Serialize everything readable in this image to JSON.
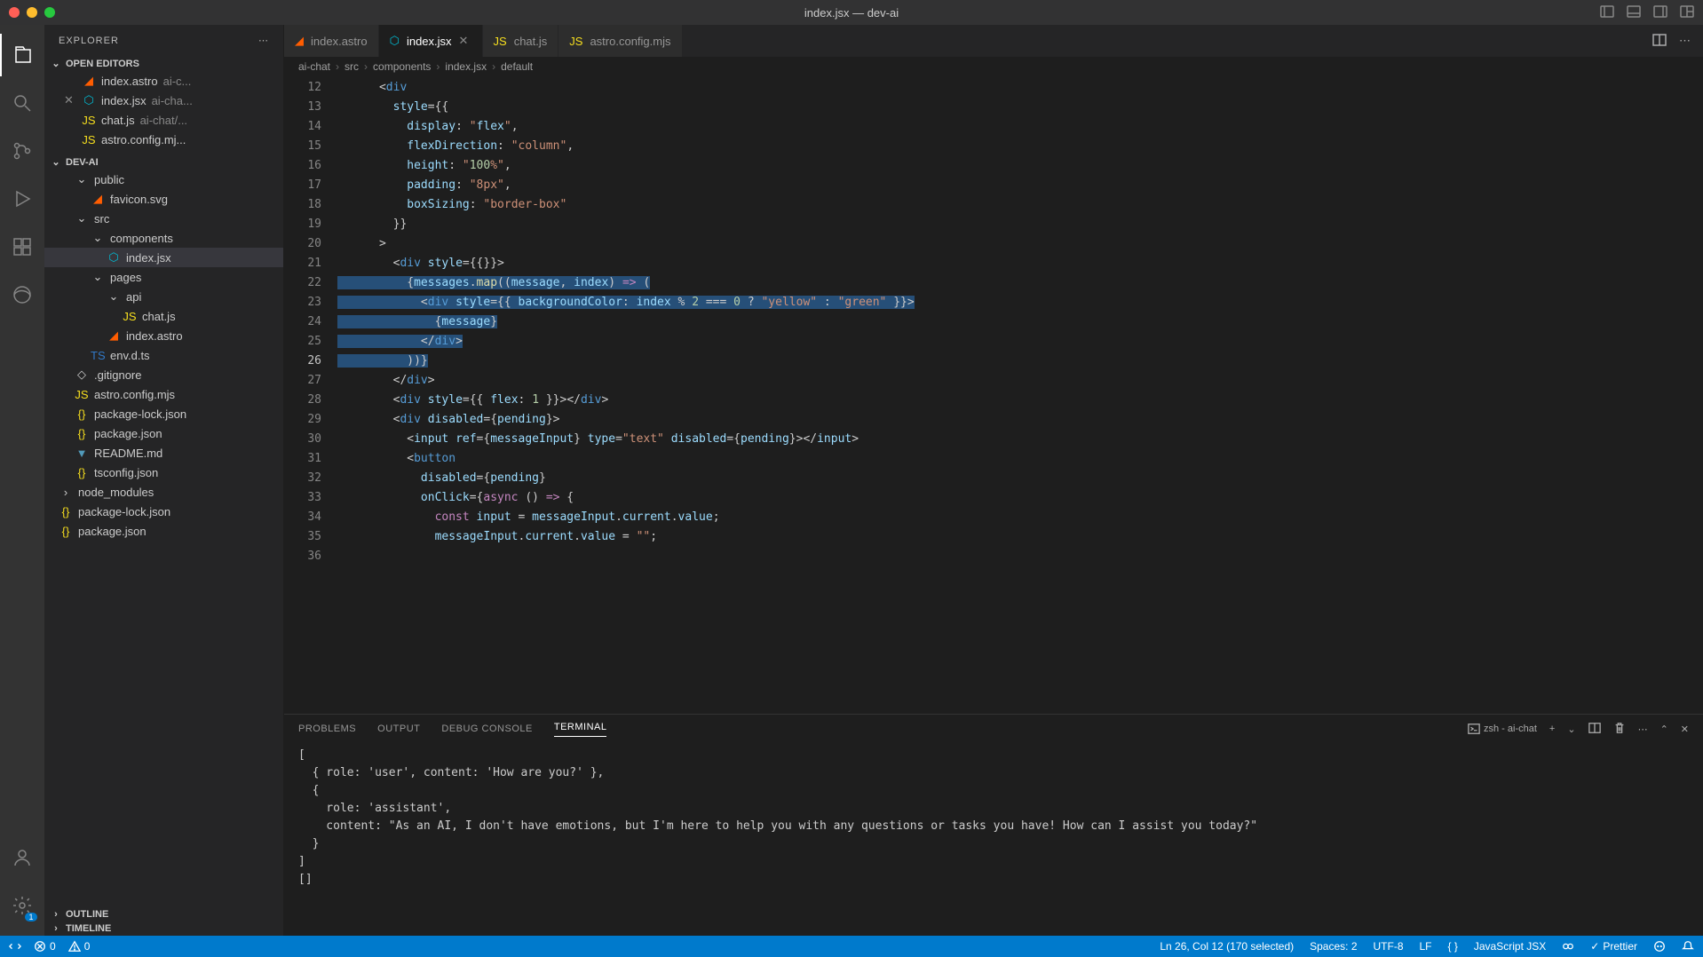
{
  "window": {
    "title": "index.jsx — dev-ai"
  },
  "explorer": {
    "title": "EXPLORER",
    "openEditorsLabel": "OPEN EDITORS",
    "projectLabel": "DEV-AI",
    "outlineLabel": "OUTLINE",
    "timelineLabel": "TIMELINE",
    "openEditors": [
      {
        "name": "index.astro",
        "path": "ai-c..."
      },
      {
        "name": "index.jsx",
        "path": "ai-cha..."
      },
      {
        "name": "chat.js",
        "path": "ai-chat/..."
      },
      {
        "name": "astro.config.mj...",
        "path": ""
      }
    ],
    "tree": [
      {
        "type": "folder",
        "depth": 1,
        "name": "public",
        "open": true
      },
      {
        "type": "file",
        "depth": 2,
        "name": "favicon.svg",
        "icon": "astro"
      },
      {
        "type": "folder",
        "depth": 1,
        "name": "src",
        "open": true
      },
      {
        "type": "folder",
        "depth": 2,
        "name": "components",
        "open": true
      },
      {
        "type": "file",
        "depth": 3,
        "name": "index.jsx",
        "icon": "jsx",
        "selected": true
      },
      {
        "type": "folder",
        "depth": 2,
        "name": "pages",
        "open": true
      },
      {
        "type": "folder",
        "depth": 3,
        "name": "api",
        "open": true
      },
      {
        "type": "file",
        "depth": 4,
        "name": "chat.js",
        "icon": "js"
      },
      {
        "type": "file",
        "depth": 3,
        "name": "index.astro",
        "icon": "astro"
      },
      {
        "type": "file",
        "depth": 2,
        "name": "env.d.ts",
        "icon": "ts"
      },
      {
        "type": "file",
        "depth": 1,
        "name": ".gitignore",
        "icon": ""
      },
      {
        "type": "file",
        "depth": 1,
        "name": "astro.config.mjs",
        "icon": "js"
      },
      {
        "type": "file",
        "depth": 1,
        "name": "package-lock.json",
        "icon": "json"
      },
      {
        "type": "file",
        "depth": 1,
        "name": "package.json",
        "icon": "json"
      },
      {
        "type": "file",
        "depth": 1,
        "name": "README.md",
        "icon": "md"
      },
      {
        "type": "file",
        "depth": 1,
        "name": "tsconfig.json",
        "icon": "json"
      },
      {
        "type": "folder",
        "depth": 0,
        "name": "node_modules",
        "open": false
      },
      {
        "type": "file",
        "depth": 0,
        "name": "package-lock.json",
        "icon": "json"
      },
      {
        "type": "file",
        "depth": 0,
        "name": "package.json",
        "icon": "json"
      }
    ]
  },
  "tabs": [
    {
      "name": "index.astro",
      "icon": "astro"
    },
    {
      "name": "index.jsx",
      "icon": "jsx",
      "active": true,
      "close": true
    },
    {
      "name": "chat.js",
      "icon": "js"
    },
    {
      "name": "astro.config.mjs",
      "icon": "js"
    }
  ],
  "breadcrumb": [
    "ai-chat",
    "src",
    "components",
    "index.jsx",
    "default"
  ],
  "code": {
    "startLine": 12,
    "currentLine": 26,
    "lines": [
      "      <div",
      "        style={{",
      "          display: \"flex\",",
      "          flexDirection: \"column\",",
      "          height: \"100%\",",
      "          padding: \"8px\",",
      "          boxSizing: \"border-box\"",
      "        }}",
      "      >",
      "        <div style={{}}>",
      "          {messages.map((message, index) => (",
      "            <div style={{ backgroundColor: index % 2 === 0 ? \"yellow\" : \"green\" }}>",
      "              {message}",
      "            </div>",
      "          ))}",
      "        </div>",
      "        <div style={{ flex: 1 }}></div>",
      "        <div disabled={pending}>",
      "          <input ref={messageInput} type=\"text\" disabled={pending}></input>",
      "          <button",
      "            disabled={pending}",
      "            onClick={async () => {",
      "              const input = messageInput.current.value;",
      "              messageInput.current.value = \"\";",
      ""
    ],
    "selectedLines": [
      22,
      23,
      24,
      25,
      26
    ]
  },
  "panel": {
    "tabs": [
      "PROBLEMS",
      "OUTPUT",
      "DEBUG CONSOLE",
      "TERMINAL"
    ],
    "activeTab": 3,
    "shellLabel": "zsh - ai-chat",
    "terminal": "[\n  { role: 'user', content: 'How are you?' },\n  {\n    role: 'assistant',\n    content: \"As an AI, I don't have emotions, but I'm here to help you with any questions or tasks you have! How can I assist you today?\"\n  }\n]\n[]"
  },
  "status": {
    "errors": "0",
    "warnings": "0",
    "cursor": "Ln 26, Col 12 (170 selected)",
    "spaces": "Spaces: 2",
    "encoding": "UTF-8",
    "eol": "LF",
    "lang": "JavaScript JSX",
    "prettier": "Prettier",
    "gearBadge": "1"
  }
}
